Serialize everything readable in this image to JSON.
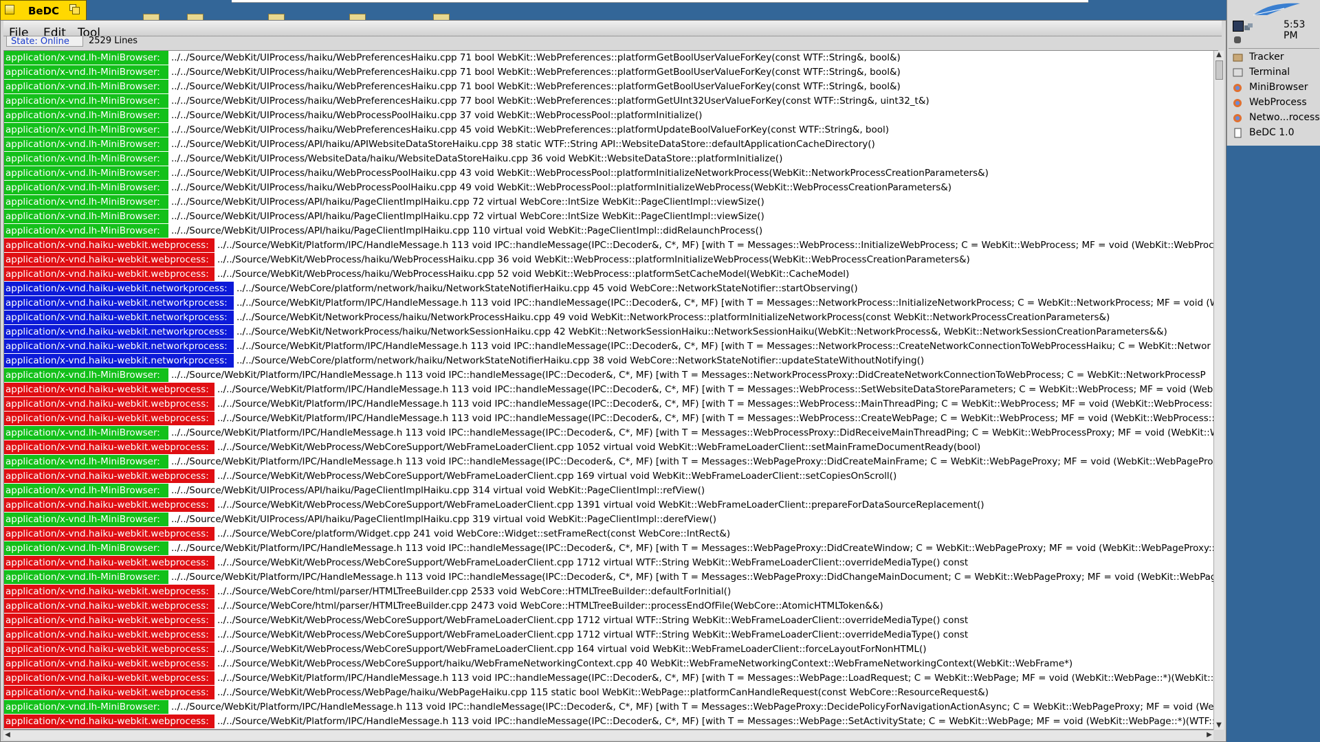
{
  "window": {
    "title": "BeDC",
    "menus": [
      "File",
      "Edit",
      "Tool"
    ],
    "status": "State: Online",
    "line_count": "2529 Lines"
  },
  "deskbar": {
    "clock": "5:53 PM",
    "apps": [
      "Tracker",
      "Terminal",
      "MiniBrowser",
      "WebProcess",
      "Netwo...rocess",
      "BeDC 1.0"
    ]
  },
  "colors": {
    "MiniBrowser": "#13c01a",
    "webprocess": "#e00e12",
    "networkprocess": "#0c1ad8",
    "tab_yellow": "#ffd800",
    "desktop": "#336698"
  },
  "log": [
    {
      "kind": "green",
      "proc": "application/x-vnd.lh-MiniBrowser:",
      "msg": "../../Source/WebKit/UIProcess/haiku/WebPreferencesHaiku.cpp 71 bool WebKit::WebPreferences::platformGetBoolUserValueForKey(const WTF::String&, bool&)"
    },
    {
      "kind": "green",
      "proc": "application/x-vnd.lh-MiniBrowser:",
      "msg": "../../Source/WebKit/UIProcess/haiku/WebPreferencesHaiku.cpp 71 bool WebKit::WebPreferences::platformGetBoolUserValueForKey(const WTF::String&, bool&)"
    },
    {
      "kind": "green",
      "proc": "application/x-vnd.lh-MiniBrowser:",
      "msg": "../../Source/WebKit/UIProcess/haiku/WebPreferencesHaiku.cpp 71 bool WebKit::WebPreferences::platformGetBoolUserValueForKey(const WTF::String&, bool&)"
    },
    {
      "kind": "green",
      "proc": "application/x-vnd.lh-MiniBrowser:",
      "msg": "../../Source/WebKit/UIProcess/haiku/WebPreferencesHaiku.cpp 77 bool WebKit::WebPreferences::platformGetUInt32UserValueForKey(const WTF::String&, uint32_t&)"
    },
    {
      "kind": "green",
      "proc": "application/x-vnd.lh-MiniBrowser:",
      "msg": "../../Source/WebKit/UIProcess/haiku/WebProcessPoolHaiku.cpp 37 void WebKit::WebProcessPool::platformInitialize()"
    },
    {
      "kind": "green",
      "proc": "application/x-vnd.lh-MiniBrowser:",
      "msg": "../../Source/WebKit/UIProcess/haiku/WebPreferencesHaiku.cpp 45 void WebKit::WebPreferences::platformUpdateBoolValueForKey(const WTF::String&, bool)"
    },
    {
      "kind": "green",
      "proc": "application/x-vnd.lh-MiniBrowser:",
      "msg": "../../Source/WebKit/UIProcess/API/haiku/APIWebsiteDataStoreHaiku.cpp 38 static WTF::String API::WebsiteDataStore::defaultApplicationCacheDirectory()"
    },
    {
      "kind": "green",
      "proc": "application/x-vnd.lh-MiniBrowser:",
      "msg": "../../Source/WebKit/UIProcess/WebsiteData/haiku/WebsiteDataStoreHaiku.cpp 36 void WebKit::WebsiteDataStore::platformInitialize()"
    },
    {
      "kind": "green",
      "proc": "application/x-vnd.lh-MiniBrowser:",
      "msg": "../../Source/WebKit/UIProcess/haiku/WebProcessPoolHaiku.cpp 43 void WebKit::WebProcessPool::platformInitializeNetworkProcess(WebKit::NetworkProcessCreationParameters&)"
    },
    {
      "kind": "green",
      "proc": "application/x-vnd.lh-MiniBrowser:",
      "msg": "../../Source/WebKit/UIProcess/haiku/WebProcessPoolHaiku.cpp 49 void WebKit::WebProcessPool::platformInitializeWebProcess(WebKit::WebProcessCreationParameters&)"
    },
    {
      "kind": "green",
      "proc": "application/x-vnd.lh-MiniBrowser:",
      "msg": "../../Source/WebKit/UIProcess/API/haiku/PageClientImplHaiku.cpp 72 virtual WebCore::IntSize WebKit::PageClientImpl::viewSize()"
    },
    {
      "kind": "green",
      "proc": "application/x-vnd.lh-MiniBrowser:",
      "msg": "../../Source/WebKit/UIProcess/API/haiku/PageClientImplHaiku.cpp 72 virtual WebCore::IntSize WebKit::PageClientImpl::viewSize()"
    },
    {
      "kind": "green",
      "proc": "application/x-vnd.lh-MiniBrowser:",
      "msg": "../../Source/WebKit/UIProcess/API/haiku/PageClientImplHaiku.cpp 110 virtual void WebKit::PageClientImpl::didRelaunchProcess()"
    },
    {
      "kind": "red",
      "proc": "application/x-vnd.haiku-webkit.webprocess:",
      "msg": "../../Source/WebKit/Platform/IPC/HandleMessage.h 113 void IPC::handleMessage(IPC::Decoder&, C*, MF) [with T = Messages::WebProcess::InitializeWebProcess; C = WebKit::WebProcess; MF = void (WebKit::WebProc"
    },
    {
      "kind": "red",
      "proc": "application/x-vnd.haiku-webkit.webprocess:",
      "msg": "../../Source/WebKit/WebProcess/haiku/WebProcessHaiku.cpp 36 void WebKit::WebProcess::platformInitializeWebProcess(WebKit::WebProcessCreationParameters&)"
    },
    {
      "kind": "red",
      "proc": "application/x-vnd.haiku-webkit.webprocess:",
      "msg": "../../Source/WebKit/WebProcess/haiku/WebProcessHaiku.cpp 52 void WebKit::WebProcess::platformSetCacheModel(WebKit::CacheModel)"
    },
    {
      "kind": "blue",
      "proc": "application/x-vnd.haiku-webkit.networkprocess:",
      "msg": "../../Source/WebCore/platform/network/haiku/NetworkStateNotifierHaiku.cpp 45 void WebCore::NetworkStateNotifier::startObserving()"
    },
    {
      "kind": "blue",
      "proc": "application/x-vnd.haiku-webkit.networkprocess:",
      "msg": "../../Source/WebKit/Platform/IPC/HandleMessage.h 113 void IPC::handleMessage(IPC::Decoder&, C*, MF) [with T = Messages::NetworkProcess::InitializeNetworkProcess; C = WebKit::NetworkProcess; MF = void (W"
    },
    {
      "kind": "blue",
      "proc": "application/x-vnd.haiku-webkit.networkprocess:",
      "msg": "../../Source/WebKit/NetworkProcess/haiku/NetworkProcessHaiku.cpp 49 void WebKit::NetworkProcess::platformInitializeNetworkProcess(const WebKit::NetworkProcessCreationParameters&)"
    },
    {
      "kind": "blue",
      "proc": "application/x-vnd.haiku-webkit.networkprocess:",
      "msg": "../../Source/WebKit/NetworkProcess/haiku/NetworkSessionHaiku.cpp 42 WebKit::NetworkSessionHaiku::NetworkSessionHaiku(WebKit::NetworkProcess&, WebKit::NetworkSessionCreationParameters&&)"
    },
    {
      "kind": "blue",
      "proc": "application/x-vnd.haiku-webkit.networkprocess:",
      "msg": "../../Source/WebKit/Platform/IPC/HandleMessage.h 113 void IPC::handleMessage(IPC::Decoder&, C*, MF) [with T = Messages::NetworkProcess::CreateNetworkConnectionToWebProcessHaiku; C = WebKit::Networ"
    },
    {
      "kind": "blue",
      "proc": "application/x-vnd.haiku-webkit.networkprocess:",
      "msg": "../../Source/WebCore/platform/network/haiku/NetworkStateNotifierHaiku.cpp 38 void WebCore::NetworkStateNotifier::updateStateWithoutNotifying()"
    },
    {
      "kind": "green",
      "proc": "application/x-vnd.lh-MiniBrowser:",
      "msg": "../../Source/WebKit/Platform/IPC/HandleMessage.h 113 void IPC::handleMessage(IPC::Decoder&, C*, MF) [with T = Messages::NetworkProcessProxy::DidCreateNetworkConnectionToWebProcess; C = WebKit::NetworkProcessP"
    },
    {
      "kind": "red",
      "proc": "application/x-vnd.haiku-webkit.webprocess:",
      "msg": "../../Source/WebKit/Platform/IPC/HandleMessage.h 113 void IPC::handleMessage(IPC::Decoder&, C*, MF) [with T = Messages::WebProcess::SetWebsiteDataStoreParameters; C = WebKit::WebProcess; MF = void (WebK"
    },
    {
      "kind": "red",
      "proc": "application/x-vnd.haiku-webkit.webprocess:",
      "msg": "../../Source/WebKit/Platform/IPC/HandleMessage.h 113 void IPC::handleMessage(IPC::Decoder&, C*, MF) [with T = Messages::WebProcess::MainThreadPing; C = WebKit::WebProcess; MF = void (WebKit::WebProcess::"
    },
    {
      "kind": "red",
      "proc": "application/x-vnd.haiku-webkit.webprocess:",
      "msg": "../../Source/WebKit/Platform/IPC/HandleMessage.h 113 void IPC::handleMessage(IPC::Decoder&, C*, MF) [with T = Messages::WebProcess::CreateWebPage; C = WebKit::WebProcess; MF = void (WebKit::WebProcess::"
    },
    {
      "kind": "green",
      "proc": "application/x-vnd.lh-MiniBrowser:",
      "msg": "../../Source/WebKit/Platform/IPC/HandleMessage.h 113 void IPC::handleMessage(IPC::Decoder&, C*, MF) [with T = Messages::WebProcessProxy::DidReceiveMainThreadPing; C = WebKit::WebProcessProxy; MF = void (WebKit::W"
    },
    {
      "kind": "red",
      "proc": "application/x-vnd.haiku-webkit.webprocess:",
      "msg": "../../Source/WebKit/WebProcess/WebCoreSupport/WebFrameLoaderClient.cpp 1052 virtual void WebKit::WebFrameLoaderClient::setMainFrameDocumentReady(bool)"
    },
    {
      "kind": "green",
      "proc": "application/x-vnd.lh-MiniBrowser:",
      "msg": "../../Source/WebKit/Platform/IPC/HandleMessage.h 113 void IPC::handleMessage(IPC::Decoder&, C*, MF) [with T = Messages::WebPageProxy::DidCreateMainFrame; C = WebKit::WebPageProxy; MF = void (WebKit::WebPagePro"
    },
    {
      "kind": "red",
      "proc": "application/x-vnd.haiku-webkit.webprocess:",
      "msg": "../../Source/WebKit/WebProcess/WebCoreSupport/WebFrameLoaderClient.cpp 169 virtual void WebKit::WebFrameLoaderClient::setCopiesOnScroll()"
    },
    {
      "kind": "green",
      "proc": "application/x-vnd.lh-MiniBrowser:",
      "msg": "../../Source/WebKit/UIProcess/API/haiku/PageClientImplHaiku.cpp 314 virtual void WebKit::PageClientImpl::refView()"
    },
    {
      "kind": "red",
      "proc": "application/x-vnd.haiku-webkit.webprocess:",
      "msg": "../../Source/WebKit/WebProcess/WebCoreSupport/WebFrameLoaderClient.cpp 1391 virtual void WebKit::WebFrameLoaderClient::prepareForDataSourceReplacement()"
    },
    {
      "kind": "green",
      "proc": "application/x-vnd.lh-MiniBrowser:",
      "msg": "../../Source/WebKit/UIProcess/API/haiku/PageClientImplHaiku.cpp 319 virtual void WebKit::PageClientImpl::derefView()"
    },
    {
      "kind": "red",
      "proc": "application/x-vnd.haiku-webkit.webprocess:",
      "msg": "../../Source/WebCore/platform/Widget.cpp 241 void WebCore::Widget::setFrameRect(const WebCore::IntRect&)"
    },
    {
      "kind": "green",
      "proc": "application/x-vnd.lh-MiniBrowser:",
      "msg": "../../Source/WebKit/Platform/IPC/HandleMessage.h 113 void IPC::handleMessage(IPC::Decoder&, C*, MF) [with T = Messages::WebPageProxy::DidCreateWindow; C = WebKit::WebPageProxy; MF = void (WebKit::WebPageProxy::"
    },
    {
      "kind": "red",
      "proc": "application/x-vnd.haiku-webkit.webprocess:",
      "msg": "../../Source/WebKit/WebProcess/WebCoreSupport/WebFrameLoaderClient.cpp 1712 virtual WTF::String WebKit::WebFrameLoaderClient::overrideMediaType() const"
    },
    {
      "kind": "green",
      "proc": "application/x-vnd.lh-MiniBrowser:",
      "msg": "../../Source/WebKit/Platform/IPC/HandleMessage.h 113 void IPC::handleMessage(IPC::Decoder&, C*, MF) [with T = Messages::WebPageProxy::DidChangeMainDocument; C = WebKit::WebPageProxy; MF = void (WebKit::WebPag"
    },
    {
      "kind": "red",
      "proc": "application/x-vnd.haiku-webkit.webprocess:",
      "msg": "../../Source/WebCore/html/parser/HTMLTreeBuilder.cpp 2533 void WebCore::HTMLTreeBuilder::defaultForInitial()"
    },
    {
      "kind": "red",
      "proc": "application/x-vnd.haiku-webkit.webprocess:",
      "msg": "../../Source/WebCore/html/parser/HTMLTreeBuilder.cpp 2473 void WebCore::HTMLTreeBuilder::processEndOfFile(WebCore::AtomicHTMLToken&&)"
    },
    {
      "kind": "red",
      "proc": "application/x-vnd.haiku-webkit.webprocess:",
      "msg": "../../Source/WebKit/WebProcess/WebCoreSupport/WebFrameLoaderClient.cpp 1712 virtual WTF::String WebKit::WebFrameLoaderClient::overrideMediaType() const"
    },
    {
      "kind": "red",
      "proc": "application/x-vnd.haiku-webkit.webprocess:",
      "msg": "../../Source/WebKit/WebProcess/WebCoreSupport/WebFrameLoaderClient.cpp 1712 virtual WTF::String WebKit::WebFrameLoaderClient::overrideMediaType() const"
    },
    {
      "kind": "red",
      "proc": "application/x-vnd.haiku-webkit.webprocess:",
      "msg": "../../Source/WebKit/WebProcess/WebCoreSupport/WebFrameLoaderClient.cpp 164 virtual void WebKit::WebFrameLoaderClient::forceLayoutForNonHTML()"
    },
    {
      "kind": "red",
      "proc": "application/x-vnd.haiku-webkit.webprocess:",
      "msg": "../../Source/WebKit/WebProcess/WebCoreSupport/haiku/WebFrameNetworkingContext.cpp 40 WebKit::WebFrameNetworkingContext::WebFrameNetworkingContext(WebKit::WebFrame*)"
    },
    {
      "kind": "red",
      "proc": "application/x-vnd.haiku-webkit.webprocess:",
      "msg": "../../Source/WebKit/Platform/IPC/HandleMessage.h 113 void IPC::handleMessage(IPC::Decoder&, C*, MF) [with T = Messages::WebPage::LoadRequest; C = WebKit::WebPage; MF = void (WebKit::WebPage::*)(WebKit::L"
    },
    {
      "kind": "red",
      "proc": "application/x-vnd.haiku-webkit.webprocess:",
      "msg": "../../Source/WebKit/WebProcess/WebPage/haiku/WebPageHaiku.cpp 115 static bool WebKit::WebPage::platformCanHandleRequest(const WebCore::ResourceRequest&)"
    },
    {
      "kind": "green",
      "proc": "application/x-vnd.lh-MiniBrowser:",
      "msg": "../../Source/WebKit/Platform/IPC/HandleMessage.h 113 void IPC::handleMessage(IPC::Decoder&, C*, MF) [with T = Messages::WebPageProxy::DecidePolicyForNavigationActionAsync; C = WebKit::WebPageProxy; MF = void (We"
    },
    {
      "kind": "red",
      "proc": "application/x-vnd.haiku-webkit.webprocess:",
      "msg": "../../Source/WebKit/Platform/IPC/HandleMessage.h 113 void IPC::handleMessage(IPC::Decoder&, C*, MF) [with T = Messages::WebPage::SetActivityState; C = WebKit::WebPage; MF = void (WebKit::WebPage::*)(WTF::O"
    }
  ]
}
